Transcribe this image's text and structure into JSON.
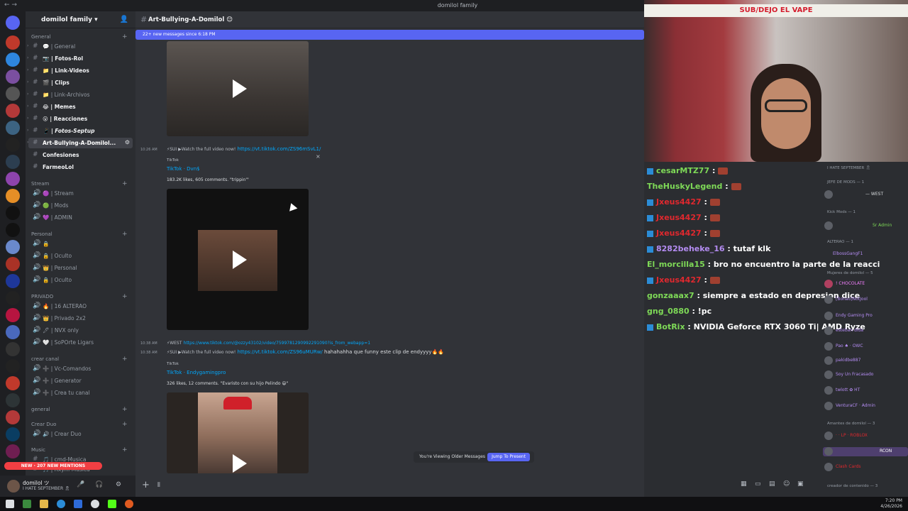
{
  "window": {
    "title": "domilol family",
    "nav": "← →"
  },
  "server": {
    "name": "domilol family ▾"
  },
  "sidebar": {
    "categories": [
      {
        "label": "General"
      },
      {
        "label": "Stream"
      },
      {
        "label": "Personal"
      },
      {
        "label": "PRIVADO"
      },
      {
        "label": "crear canal"
      },
      {
        "label": "general"
      },
      {
        "label": "Crear Duo"
      },
      {
        "label": "Music"
      }
    ],
    "channels": [
      {
        "label": "💬 | General"
      },
      {
        "label": "📷 | Fotos-Rol"
      },
      {
        "label": "📁 | Link-Videos"
      },
      {
        "label": "🎬 | Clips"
      },
      {
        "label": "📁 | Link-Archivos"
      },
      {
        "label": "😂 | Memes"
      },
      {
        "label": "😮 | Reacciones"
      },
      {
        "label": "📱 | Fotos-Septup"
      },
      {
        "label": "Art-Bullying-A-Domilol..."
      },
      {
        "label": "Confesiones"
      },
      {
        "label": "FarmeoLol"
      },
      {
        "label": "🟣 | Stream"
      },
      {
        "label": "🟢 | Mods"
      },
      {
        "label": "💜 | ADMIN"
      },
      {
        "label": "🔒"
      },
      {
        "label": "🔒 | Oculto"
      },
      {
        "label": "👑 | Personal"
      },
      {
        "label": "🔒 | Oculto"
      },
      {
        "label": "🔥 | 16 ALTERAO"
      },
      {
        "label": "👑 | Privado 2x2"
      },
      {
        "label": "🖊 | NVX only"
      },
      {
        "label": "🤍 | SoPOrte Ligars"
      },
      {
        "label": "➕ | Vc-Comandos"
      },
      {
        "label": "➕ | Generator"
      },
      {
        "label": "➕ | Crea tu canal"
      },
      {
        "label": "🔊 | Crear Duo"
      },
      {
        "label": "🎵 | cmd-Musica"
      },
      {
        "label": "🎵 | Rxym-Musica"
      }
    ],
    "mentions_pill": "NEW · 207 NEW MENTIONS"
  },
  "user": {
    "name": "domilol ツ",
    "status": "I HATE SEPTEMBER 🎗"
  },
  "channel": {
    "title": "Art-Bullying-A-Domilol 😊",
    "new_messages": "22+ new messages since 6:18 PM"
  },
  "messages": [
    {
      "time": "10:26 AM",
      "prefix": "⚡SUI ▶Watch the full video now!",
      "url": "https://vt.tiktok.com/ZS96mSvL1/",
      "text": ""
    },
    {
      "time": "10:38 AM",
      "prefix": "⚡WEST",
      "url": "https://www.tiktok.com/@ozzy43102/video/7599781290992291090?is_from_webapp=1",
      "text": ""
    },
    {
      "time": "10:38 AM",
      "prefix": "⚡SUI ▶Watch the full video now!",
      "url": "https://vt.tiktok.com/ZS96uMURw/",
      "text": "hahahahha que funny este clip de endyyyy🔥🔥"
    }
  ],
  "embeds": [
    {
      "source": "TikTok",
      "title": "TikTok · Dvn$",
      "desc": "183.2K likes, 605 comments. \"trippin'\""
    },
    {
      "source": "TikTok",
      "title": "TikTok · Endygamingpro",
      "desc": "326 likes, 12 comments. \"Evaristo con su hijo Pelindo 😄\""
    }
  ],
  "older_messages": {
    "label": "You're Viewing Older Messages",
    "button": "Jump To Present"
  },
  "webcam": {
    "banner": "SUB/DEJO EL VAPE"
  },
  "stream_chat": [
    {
      "user": "cesarMTZ77",
      "msg": ":",
      "color": "u",
      "icon": true,
      "emote": true
    },
    {
      "user": "TheHuskyLegend",
      "msg": ":",
      "color": "u",
      "icon": false,
      "emote": true
    },
    {
      "user": "Jxeus4427",
      "msg": ":",
      "color": "red",
      "icon": true,
      "emote": true
    },
    {
      "user": "Jxeus4427",
      "msg": ":",
      "color": "red",
      "icon": true,
      "emote": true
    },
    {
      "user": "Jxeus4427",
      "msg": ":",
      "color": "red",
      "icon": true,
      "emote": true
    },
    {
      "user": "8282beheke_16",
      "msg": ": tutaf klk",
      "color": "pur",
      "icon": true,
      "emote": false
    },
    {
      "user": "El_morcilla15",
      "msg": ": bro no encuentro la parte de la reacci",
      "color": "u",
      "icon": false,
      "emote": false
    },
    {
      "user": "Jxeus4427",
      "msg": ":",
      "color": "red",
      "icon": true,
      "emote": true
    },
    {
      "user": "gonzaaax7",
      "msg": ": siempre a estado en depresion dice",
      "color": "u",
      "icon": false,
      "emote": false
    },
    {
      "user": "gng_0880",
      "msg": ": !pc",
      "color": "u",
      "icon": false,
      "emote": false
    },
    {
      "user": "BotRix",
      "msg": ": NVIDIA Geforce RTX 3060 Ti| AMD Ryze",
      "color": "u",
      "icon": true,
      "emote": false
    }
  ],
  "member_list": {
    "categories": [
      {
        "label": "I HATE SEPTEMBER 🎗"
      },
      {
        "label": "JEFE DE MODS — 1"
      },
      {
        "label": "Kick Mods — 1"
      },
      {
        "label": "ALTERAO — 1"
      },
      {
        "label": "Mujeres de domilol — 5"
      },
      {
        "label": "Amantes de domilol — 3"
      },
      {
        "label": "creador de contenido — 3"
      }
    ],
    "members": [
      {
        "name": "— WEST",
        "color": "#dbdee1"
      },
      {
        "name": "Sr Admin",
        "color": "#7ed957"
      },
      {
        "name": "ElbossGangF1",
        "color": "#b48cf2"
      },
      {
        "name": "! CHOCOLATE",
        "color": "#f47fff"
      },
      {
        "name": "[Bonao]NotJool",
        "color": "#b48cf2"
      },
      {
        "name": "Endy Gaming Pro",
        "color": "#b48cf2"
      },
      {
        "name": "esteban dida",
        "color": "#b48cf2"
      },
      {
        "name": "Pao ♠ · OWC",
        "color": "#b48cf2"
      },
      {
        "name": "pakidbe887",
        "color": "#b48cf2"
      },
      {
        "name": "Soy Un Fracasado",
        "color": "#b48cf2"
      },
      {
        "name": "twlott ✿ HT",
        "color": "#b48cf2"
      },
      {
        "name": "VenturaCF · Admin",
        "color": "#b48cf2"
      },
      {
        "name": "· · LP · ROBLOX",
        "color": "#e0282e"
      },
      {
        "name": "RCON",
        "color": "#e0282e"
      },
      {
        "name": "Clash Cards",
        "color": "#e0282e"
      }
    ]
  },
  "taskbar": {
    "time": "7:20 PM",
    "date": "4/26/2026"
  }
}
